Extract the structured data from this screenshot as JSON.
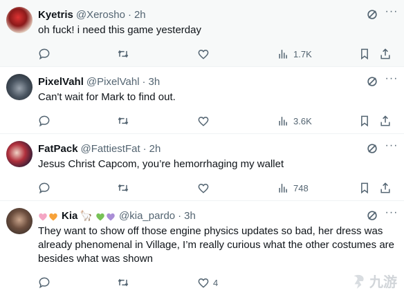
{
  "tweets": [
    {
      "name": "Kyetris",
      "handle": "@Xerosho",
      "sep": "·",
      "time": "2h",
      "text": "oh fuck! i need this game yesterday",
      "views": "1.7K",
      "likes": ""
    },
    {
      "name": "PixelVahl",
      "handle": "@PixelVahl",
      "sep": "·",
      "time": "3h",
      "text": "Can't wait for Mark to find out.",
      "views": "3.6K",
      "likes": ""
    },
    {
      "name": "FatPack",
      "handle": "@FattiestFat",
      "sep": "·",
      "time": "2h",
      "text": "Jesus Christ Capcom, you’re hemorrhaging my wallet",
      "views": "748",
      "likes": ""
    },
    {
      "name": "Kia",
      "handle": "@kia_pardo",
      "sep": "·",
      "time": "3h",
      "name_emoji": [
        "pink-heart",
        "orange-heart",
        "green-heart",
        "purple-heart"
      ],
      "name_glyph": "🦙",
      "text": "They want to show off those engine physics updates so bad, her dress was already phenomenal in Village, I’m really curious what the other costumes are besides what was shown",
      "views": "",
      "likes": "4"
    }
  ],
  "icons": {
    "reply": "reply-icon",
    "retweet": "retweet-icon",
    "like": "like-icon",
    "views": "views-icon",
    "bookmark": "bookmark-icon",
    "share": "share-icon",
    "grok": "grok-icon",
    "more": "more-icon"
  },
  "more_glyph": "···",
  "watermark": {
    "text": "九游"
  },
  "colors": {
    "text": "#0f1419",
    "muted": "#536471",
    "border": "#eff3f4",
    "hover_bg": "#f7f9f9"
  }
}
